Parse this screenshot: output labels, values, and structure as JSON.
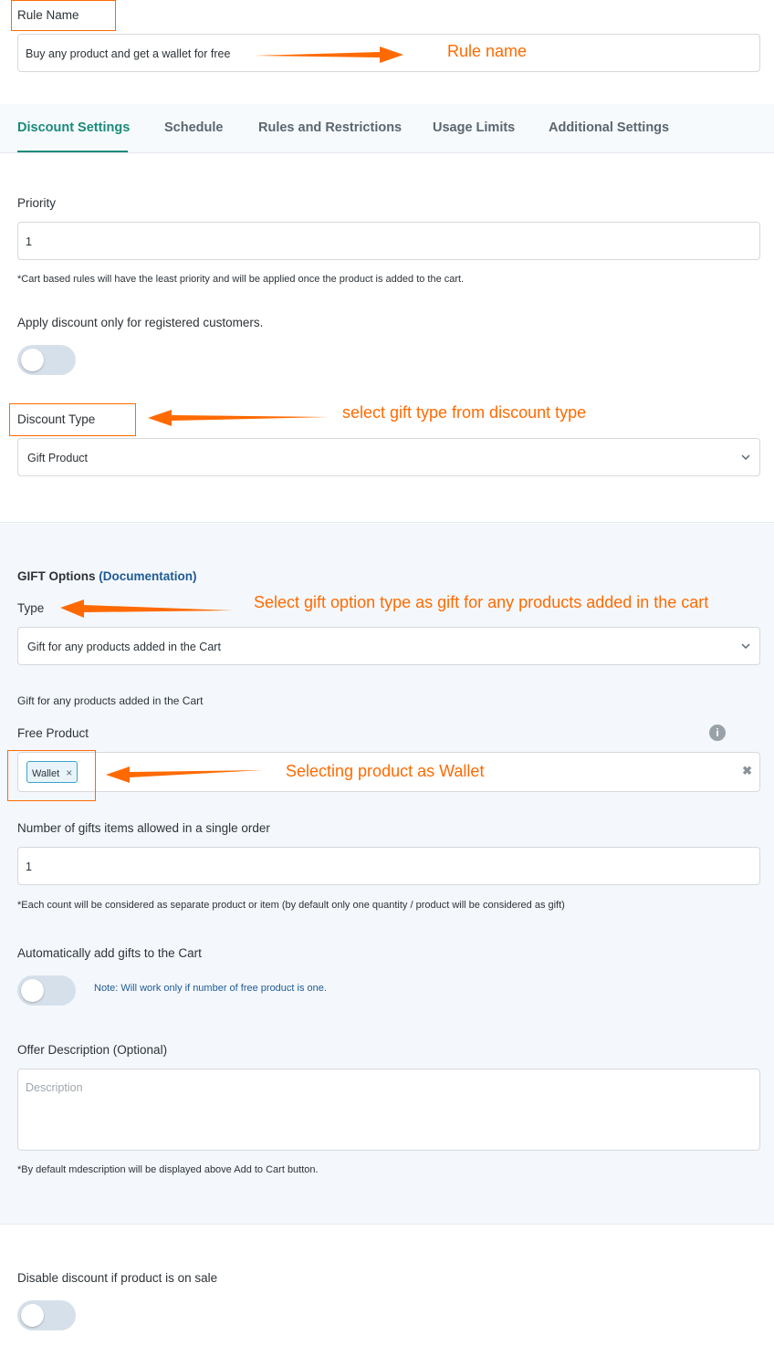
{
  "rule_name": {
    "label": "Rule Name",
    "value": "Buy any product and get a wallet for free"
  },
  "tabs": [
    {
      "label": "Discount Settings",
      "active": true
    },
    {
      "label": "Schedule"
    },
    {
      "label": "Rules and Restrictions"
    },
    {
      "label": "Usage Limits"
    },
    {
      "label": "Additional Settings"
    }
  ],
  "priority": {
    "label": "Priority",
    "value": "1",
    "note": "*Cart based rules will have the least priority and will be applied once the product is added to the cart."
  },
  "registered_only": {
    "label": "Apply discount only for registered customers.",
    "enabled": false
  },
  "discount_type": {
    "label": "Discount Type",
    "value": "Gift Product"
  },
  "gift_options": {
    "heading": "GIFT Options",
    "doc_open": "(",
    "doc_link": "Documentation",
    "doc_close": ")",
    "type_label": "Type",
    "type_value": "Gift for any products added in the Cart",
    "type_description": "Gift for any products added in the Cart",
    "free_product_label": "Free Product",
    "free_product_tag": "Wallet",
    "gift_count_label": "Number of gifts items allowed in a single order",
    "gift_count_value": "1",
    "gift_count_note": "*Each count will be considered as separate product or item (by default only one quantity / product will be considered as gift)",
    "auto_add_label": "Automatically add gifts to the Cart",
    "auto_add_enabled": false,
    "auto_add_note": "Note: Will work only if number of free product is one.",
    "offer_desc_label": "Offer Description (Optional)",
    "offer_desc_placeholder": "Description",
    "offer_desc_note": "*By default mdescription will be displayed above Add to Cart button."
  },
  "disable_on_sale": {
    "label": "Disable discount if product is on sale",
    "enabled": false
  },
  "annotations": {
    "rule_name": "Rule name",
    "discount_type": "select gift type from discount type",
    "gift_type": "Select gift option type as gift for any products added in the cart",
    "free_product": "Selecting product as Wallet"
  },
  "colors": {
    "accent": "#1a8a7a",
    "annotation": "#ff6a00",
    "link": "#1e5a96",
    "panel": "#f4f8fc"
  }
}
